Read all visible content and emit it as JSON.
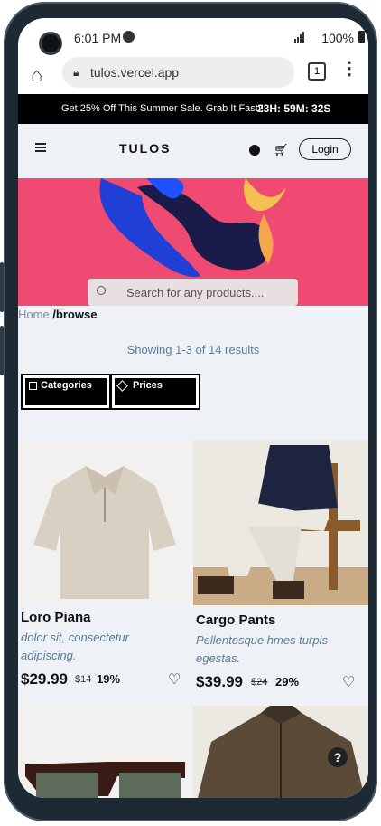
{
  "status_bar": {
    "time": "6:01 PM",
    "battery": "100%"
  },
  "browser": {
    "url": "tulos.vercel.app",
    "tab_count": "1"
  },
  "promo": {
    "message": "Get 25% Off This Summer Sale. Grab It Fast!!!",
    "countdown": "23H: 59M: 32S"
  },
  "nav": {
    "logo": "TULOS",
    "login_label": "Login"
  },
  "hero": {
    "search_placeholder": "Search for any products...."
  },
  "breadcrumb": {
    "home": "Home",
    "current": " /browse"
  },
  "results_text": "Showing 1-3 of 14 results",
  "filters": {
    "categories": "Categories",
    "prices": "Prices"
  },
  "products": [
    {
      "name": "Loro Piana",
      "description": "dolor sit, consectetur adipiscing.",
      "price": "$29.99",
      "old_price": "$14",
      "discount": "19%"
    },
    {
      "name": "Cargo Pants",
      "description": "Pellentesque hmes turpis egestas.",
      "price": "$39.99",
      "old_price": "$24",
      "discount": "29%"
    }
  ],
  "colors": {
    "promo_bg": "#000000",
    "hero_bg": "#ef4a72",
    "page_bg": "#eef2f6",
    "accent_text": "#5a7b95"
  },
  "icons": [
    "home-icon",
    "lock-icon",
    "tabs-icon",
    "menu-dots-icon",
    "hamburger-icon",
    "fire-icon",
    "cart-icon",
    "search-icon",
    "grid-icon",
    "tag-icon",
    "heart-icon",
    "help-icon"
  ]
}
